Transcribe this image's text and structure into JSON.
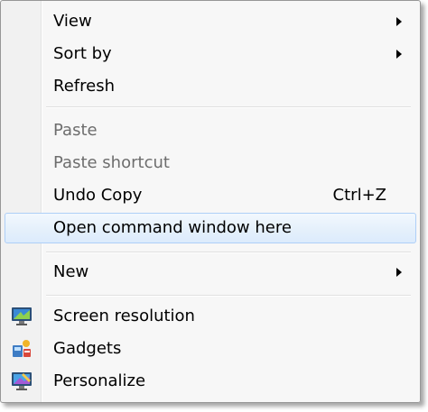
{
  "menu": {
    "view": "View",
    "sort_by": "Sort by",
    "refresh": "Refresh",
    "paste": "Paste",
    "paste_shortcut": "Paste shortcut",
    "undo_copy": "Undo Copy",
    "undo_copy_shortcut": "Ctrl+Z",
    "open_command_window": "Open command window here",
    "new": "New",
    "screen_resolution": "Screen resolution",
    "gadgets": "Gadgets",
    "personalize": "Personalize"
  },
  "icons": {
    "screen_resolution": "monitor-icon",
    "gadgets": "gadgets-icon",
    "personalize": "personalize-icon",
    "submenu_arrow": "submenu-arrow-icon"
  },
  "colors": {
    "highlight_border": "#aecff7",
    "disabled_text": "#6d6d6d"
  }
}
